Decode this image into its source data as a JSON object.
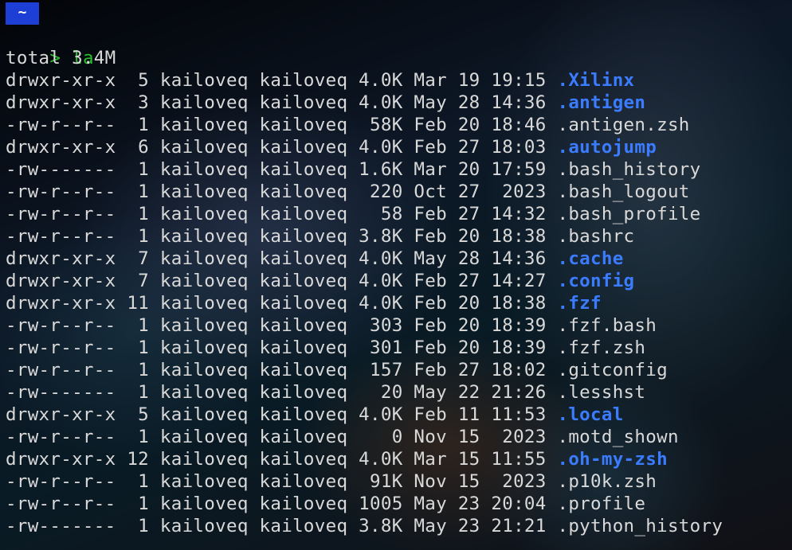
{
  "tab": {
    "label": "~"
  },
  "prompt": {
    "symbol": ">",
    "command": "la"
  },
  "total": "total 3.4M",
  "rows": [
    {
      "perm": "drwxr-xr-x",
      "links": " 5",
      "user": "kailoveq",
      "group": "kailoveq",
      "size": "4.0K",
      "month": "Mar",
      "day": "19",
      "time": "19:15",
      "name": ".Xilinx",
      "is_dir": true
    },
    {
      "perm": "drwxr-xr-x",
      "links": " 3",
      "user": "kailoveq",
      "group": "kailoveq",
      "size": "4.0K",
      "month": "May",
      "day": "28",
      "time": "14:36",
      "name": ".antigen",
      "is_dir": true
    },
    {
      "perm": "-rw-r--r--",
      "links": " 1",
      "user": "kailoveq",
      "group": "kailoveq",
      "size": " 58K",
      "month": "Feb",
      "day": "20",
      "time": "18:46",
      "name": ".antigen.zsh",
      "is_dir": false
    },
    {
      "perm": "drwxr-xr-x",
      "links": " 6",
      "user": "kailoveq",
      "group": "kailoveq",
      "size": "4.0K",
      "month": "Feb",
      "day": "27",
      "time": "18:03",
      "name": ".autojump",
      "is_dir": true
    },
    {
      "perm": "-rw-------",
      "links": " 1",
      "user": "kailoveq",
      "group": "kailoveq",
      "size": "1.6K",
      "month": "Mar",
      "day": "20",
      "time": "17:59",
      "name": ".bash_history",
      "is_dir": false
    },
    {
      "perm": "-rw-r--r--",
      "links": " 1",
      "user": "kailoveq",
      "group": "kailoveq",
      "size": " 220",
      "month": "Oct",
      "day": "27",
      "time": " 2023",
      "name": ".bash_logout",
      "is_dir": false
    },
    {
      "perm": "-rw-r--r--",
      "links": " 1",
      "user": "kailoveq",
      "group": "kailoveq",
      "size": "  58",
      "month": "Feb",
      "day": "27",
      "time": "14:32",
      "name": ".bash_profile",
      "is_dir": false
    },
    {
      "perm": "-rw-r--r--",
      "links": " 1",
      "user": "kailoveq",
      "group": "kailoveq",
      "size": "3.8K",
      "month": "Feb",
      "day": "20",
      "time": "18:38",
      "name": ".bashrc",
      "is_dir": false
    },
    {
      "perm": "drwxr-xr-x",
      "links": " 7",
      "user": "kailoveq",
      "group": "kailoveq",
      "size": "4.0K",
      "month": "May",
      "day": "28",
      "time": "14:36",
      "name": ".cache",
      "is_dir": true
    },
    {
      "perm": "drwxr-xr-x",
      "links": " 7",
      "user": "kailoveq",
      "group": "kailoveq",
      "size": "4.0K",
      "month": "Feb",
      "day": "27",
      "time": "14:27",
      "name": ".config",
      "is_dir": true
    },
    {
      "perm": "drwxr-xr-x",
      "links": "11",
      "user": "kailoveq",
      "group": "kailoveq",
      "size": "4.0K",
      "month": "Feb",
      "day": "20",
      "time": "18:38",
      "name": ".fzf",
      "is_dir": true
    },
    {
      "perm": "-rw-r--r--",
      "links": " 1",
      "user": "kailoveq",
      "group": "kailoveq",
      "size": " 303",
      "month": "Feb",
      "day": "20",
      "time": "18:39",
      "name": ".fzf.bash",
      "is_dir": false
    },
    {
      "perm": "-rw-r--r--",
      "links": " 1",
      "user": "kailoveq",
      "group": "kailoveq",
      "size": " 301",
      "month": "Feb",
      "day": "20",
      "time": "18:39",
      "name": ".fzf.zsh",
      "is_dir": false
    },
    {
      "perm": "-rw-r--r--",
      "links": " 1",
      "user": "kailoveq",
      "group": "kailoveq",
      "size": " 157",
      "month": "Feb",
      "day": "27",
      "time": "18:02",
      "name": ".gitconfig",
      "is_dir": false
    },
    {
      "perm": "-rw-------",
      "links": " 1",
      "user": "kailoveq",
      "group": "kailoveq",
      "size": "  20",
      "month": "May",
      "day": "22",
      "time": "21:26",
      "name": ".lesshst",
      "is_dir": false
    },
    {
      "perm": "drwxr-xr-x",
      "links": " 5",
      "user": "kailoveq",
      "group": "kailoveq",
      "size": "4.0K",
      "month": "Feb",
      "day": "11",
      "time": "11:53",
      "name": ".local",
      "is_dir": true
    },
    {
      "perm": "-rw-r--r--",
      "links": " 1",
      "user": "kailoveq",
      "group": "kailoveq",
      "size": "   0",
      "month": "Nov",
      "day": "15",
      "time": " 2023",
      "name": ".motd_shown",
      "is_dir": false
    },
    {
      "perm": "drwxr-xr-x",
      "links": "12",
      "user": "kailoveq",
      "group": "kailoveq",
      "size": "4.0K",
      "month": "Mar",
      "day": "15",
      "time": "11:55",
      "name": ".oh-my-zsh",
      "is_dir": true
    },
    {
      "perm": "-rw-r--r--",
      "links": " 1",
      "user": "kailoveq",
      "group": "kailoveq",
      "size": " 91K",
      "month": "Nov",
      "day": "15",
      "time": " 2023",
      "name": ".p10k.zsh",
      "is_dir": false
    },
    {
      "perm": "-rw-r--r--",
      "links": " 1",
      "user": "kailoveq",
      "group": "kailoveq",
      "size": "1005",
      "month": "May",
      "day": "23",
      "time": "20:04",
      "name": ".profile",
      "is_dir": false
    },
    {
      "perm": "-rw-------",
      "links": " 1",
      "user": "kailoveq",
      "group": "kailoveq",
      "size": "3.8K",
      "month": "May",
      "day": "23",
      "time": "21:21",
      "name": ".python_history",
      "is_dir": false
    }
  ],
  "colors": {
    "directory": "#3b7cff",
    "file": "#d9d9d9",
    "prompt": "#25c229",
    "tab_badge": "#1d3fd6"
  }
}
